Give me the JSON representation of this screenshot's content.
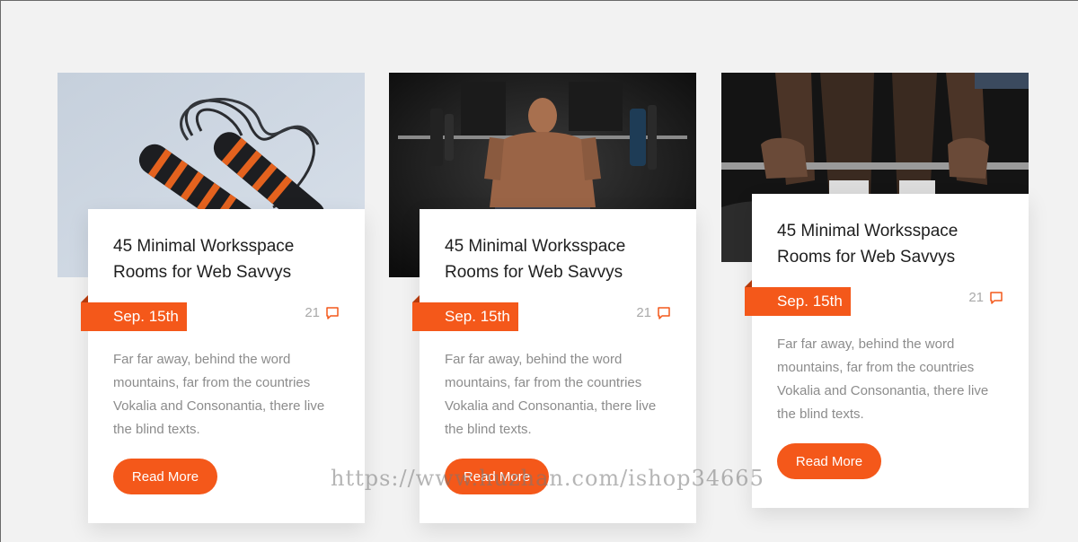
{
  "posts": [
    {
      "title": "45 Minimal Worksspace Rooms for Web Savvys",
      "date": "Sep. 15th",
      "comment_count": "21",
      "excerpt": "Far far away, behind the word mountains, far from the countries Vokalia and Consonantia, there live the blind texts.",
      "button_label": "Read More",
      "image": "jump-rope-photo"
    },
    {
      "title": "45 Minimal Worksspace Rooms for Web Savvys",
      "date": "Sep. 15th",
      "comment_count": "21",
      "excerpt": "Far far away, behind the word mountains, far from the countries Vokalia and Consonantia, there live the blind texts.",
      "button_label": "Read More",
      "image": "weightlifter-photo"
    },
    {
      "title": "45 Minimal Worksspace Rooms for Web Savvys",
      "date": "Sep. 15th",
      "comment_count": "21",
      "excerpt": "Far far away, behind the word mountains, far from the countries Vokalia and Consonantia, there live the blind texts.",
      "button_label": "Read More",
      "image": "barbell-grip-photo"
    }
  ],
  "watermark": "https://www.huzhan.com/ishop34665",
  "colors": {
    "accent": "#f4581a",
    "background": "#f2f2f2",
    "card": "#ffffff"
  },
  "icons": {
    "comments": "comment-bubble-icon"
  }
}
